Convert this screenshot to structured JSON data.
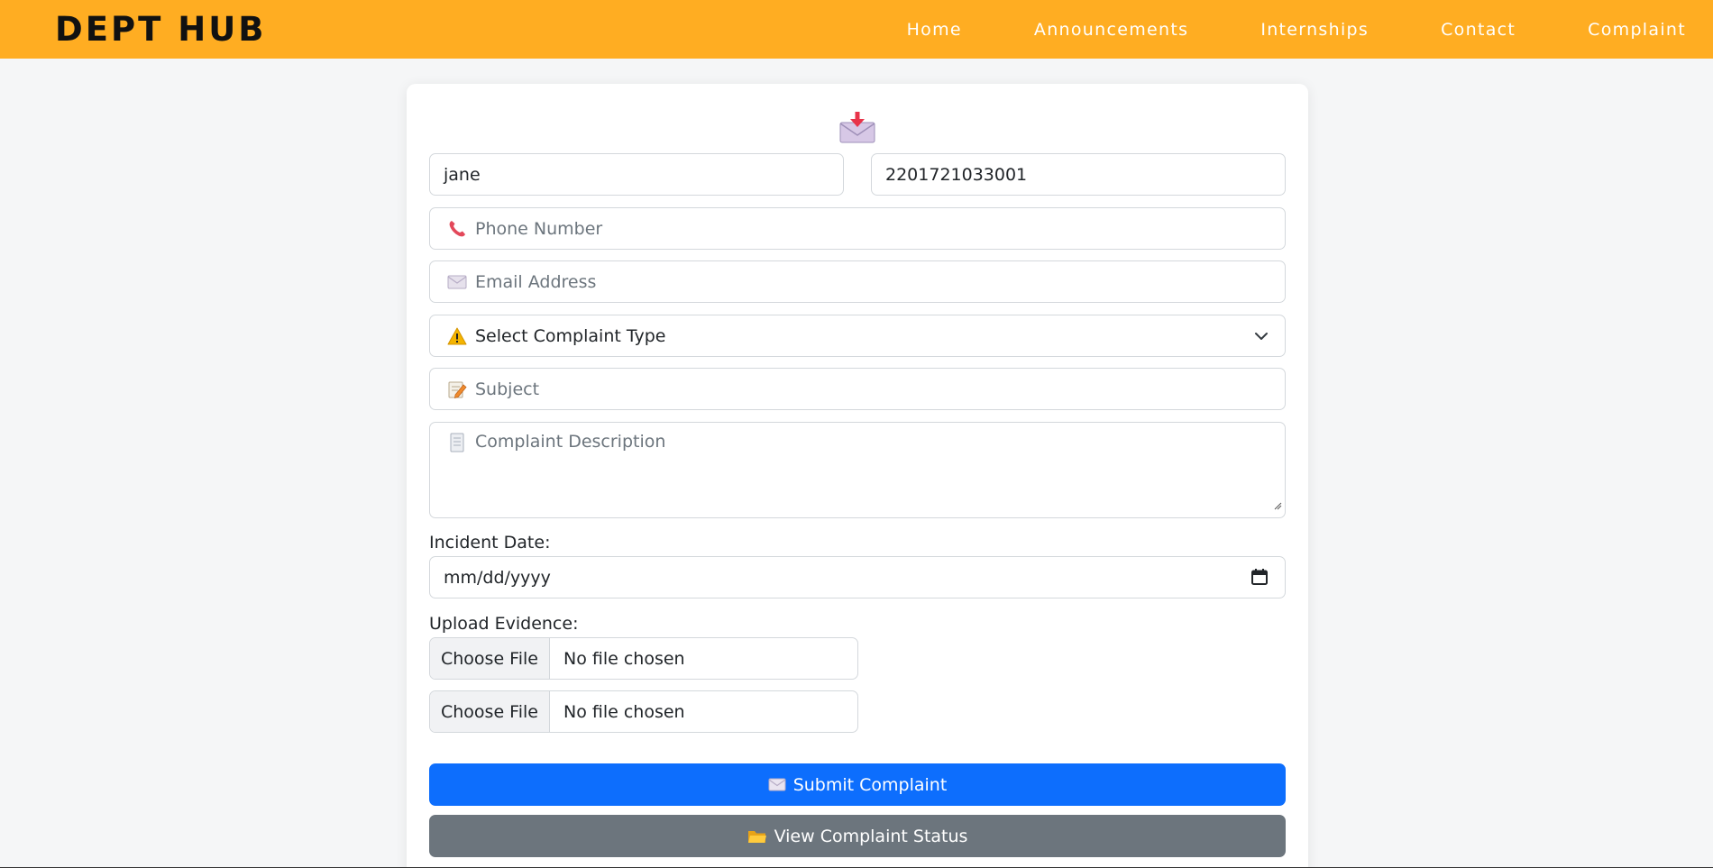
{
  "navbar": {
    "brand": "DEPT HUB",
    "links": [
      "Home",
      "Announcements",
      "Internships",
      "Contact",
      "Complaint"
    ]
  },
  "form": {
    "header_icon": "incoming-envelope-icon",
    "name_value": "jane",
    "roll_value": "2201721033001",
    "phone_placeholder": "Phone Number",
    "phone_icon": "telephone-icon",
    "email_placeholder": "Email Address",
    "email_icon": "envelope-icon",
    "complaint_type_selected": "Select Complaint Type",
    "complaint_type_icon": "warning-icon",
    "subject_placeholder": "Subject",
    "subject_icon": "memo-icon",
    "description_placeholder": "Complaint Description",
    "description_icon": "page-icon",
    "incident_date_label": "Incident Date:",
    "incident_date_value": "mm/dd/yyyy",
    "upload_label": "Upload Evidence:",
    "file_inputs": [
      {
        "button": "Choose File",
        "status": "No file chosen"
      },
      {
        "button": "Choose File",
        "status": "No file chosen"
      }
    ],
    "submit_label": "Submit Complaint",
    "status_label": "View Complaint Status"
  },
  "colors": {
    "navbar": "#ffad22",
    "primary": "#0d6efd",
    "secondary": "#6c757d"
  }
}
